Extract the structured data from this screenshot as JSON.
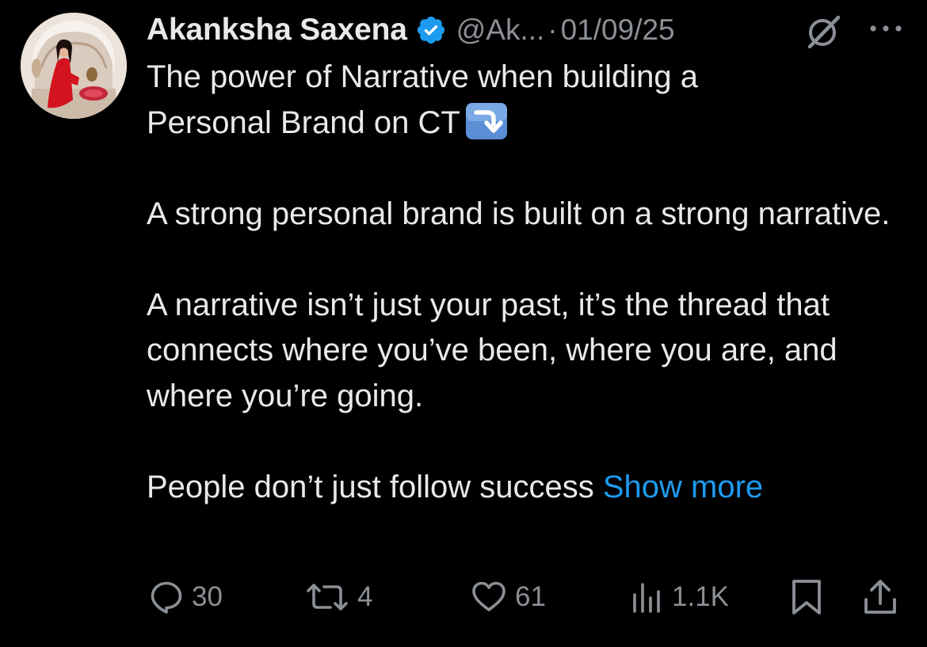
{
  "author": {
    "name": "Akanksha Saxena",
    "handle": "@Ak...",
    "separator": "·",
    "date": "01/09/25"
  },
  "tweet": {
    "line1": "The power of Narrative when building a",
    "line2": "Personal Brand on CT",
    "para2": "A strong personal brand is built on a strong narrative.",
    "para3": "A narrative isn’t just your past, it’s the thread that connects where you’ve been, where you are, and where you’re going.",
    "para4": "People don’t just follow success",
    "show_more": "Show more"
  },
  "actions": {
    "replies": "30",
    "reposts": "4",
    "likes": "61",
    "views": "1.1K"
  },
  "colors": {
    "background": "#000000",
    "text": "#e7e9ea",
    "muted": "#8b9096",
    "accent": "#1d9bf0",
    "verified_badge": "#1d9bf0"
  },
  "icons": {
    "verified": "verified-badge-icon",
    "grok": "grok-icon",
    "more": "more-options-icon",
    "emoji": "right-arrow-curving-down-emoji",
    "reply": "reply-icon",
    "repost": "repost-icon",
    "like": "heart-icon",
    "views": "views-icon",
    "bookmark": "bookmark-icon",
    "share": "share-icon"
  }
}
